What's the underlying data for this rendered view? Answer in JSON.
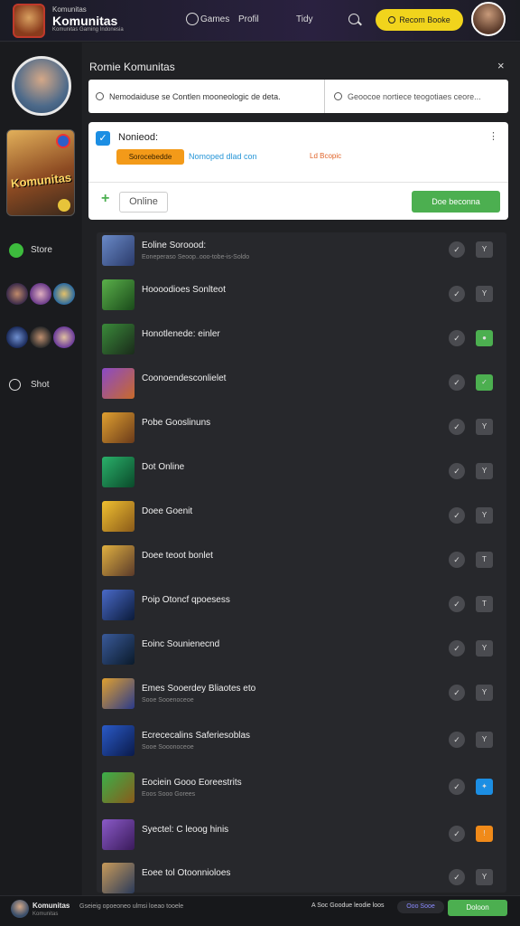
{
  "header": {
    "logo_top": "Komunitas",
    "logo_main": "Komunitas",
    "logo_sub": "Komunitas Gaming Indonesia",
    "nav_items": [
      "Games",
      "Profil",
      "Tidy"
    ],
    "cta_label": "Recom Booke"
  },
  "sidebar": {
    "game_title": "Komunitas",
    "store_label": "Store",
    "shot_label": "Shot"
  },
  "panel": {
    "title": "Romie Komunitas",
    "close": "×",
    "search_left_placeholder": "Nemodaiduse se Contlen mooneologic de deta.",
    "search_right_placeholder": "Geoocoe nortiece teogotiaes ceore..."
  },
  "card": {
    "title": "Nonieod:",
    "menu": "⋮",
    "badge": "Sorocebedde",
    "link1": "Nomoped dlad con",
    "link2": "Ld Bcopic",
    "status": "Online",
    "button": "Doe beconna",
    "plus": "+"
  },
  "rows": [
    {
      "name": "Eoline Soroood:",
      "sub": "Eoneperaso Seoop..ooo-tobe-is-Soldo"
    },
    {
      "name": "Hoooodioes Sonlteot",
      "sub": ""
    },
    {
      "name": "Honotlenede: einler",
      "sub": ""
    },
    {
      "name": "Coonoendesconlielet",
      "sub": ""
    },
    {
      "name": "Pobe Gooslinuns",
      "sub": ""
    },
    {
      "name": "Dot Online",
      "sub": ""
    },
    {
      "name": "Doee Goenit",
      "sub": ""
    },
    {
      "name": "Doee teoot bonlet",
      "sub": ""
    },
    {
      "name": "Poip Otoncf qpoesess",
      "sub": ""
    },
    {
      "name": "Eoinc Sounienecnd",
      "sub": ""
    },
    {
      "name": "Emes Sooerdey Bliaotes eto",
      "sub": "Sooe Sooenoceoe"
    },
    {
      "name": "Ecrececalins Saferiesoblas",
      "sub": "Sooe Sooonoceoe"
    },
    {
      "name": "Eociein Gooo Eoreestrits",
      "sub": "Eoos Sooo Gorees"
    },
    {
      "name": "Syectel: C leoog hinis",
      "sub": ""
    },
    {
      "name": "Eoee tol Otoonnioloes",
      "sub": ""
    }
  ],
  "footer": {
    "name": "Komunitas",
    "sub": "Komunitas",
    "text": "Gseieig opoeoneo ulmsi loeao tooele",
    "tag1": "A Soc Goodue leodie loos",
    "tag2": "Ooo Sooe",
    "button": "Doloon"
  }
}
